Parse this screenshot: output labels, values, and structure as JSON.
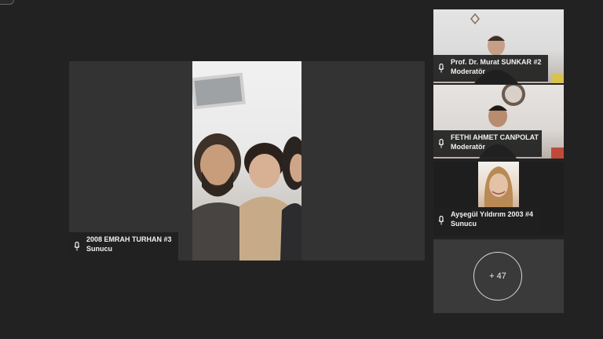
{
  "main": {
    "presenter": {
      "name": "2008 EMRAH TURHAN #3",
      "role": "Sunucu",
      "icon": "mic-icon"
    }
  },
  "sidebar": {
    "participants": [
      {
        "name": "Prof. Dr. Murat SUNKAR #2",
        "role": "Moderatör",
        "icon": "mic-icon"
      },
      {
        "name": "FETHI AHMET CANPOLAT",
        "role": "Moderatör",
        "icon": "mic-icon"
      },
      {
        "name": "Ayşegül Yıldırım 2003 #4",
        "role": "Sunucu",
        "icon": "mic-icon"
      }
    ],
    "overflow_label": "+ 47"
  },
  "colors": {
    "background": "#222222",
    "stage": "#333333",
    "namebar": "#202020",
    "text": "#f2f2f2"
  }
}
